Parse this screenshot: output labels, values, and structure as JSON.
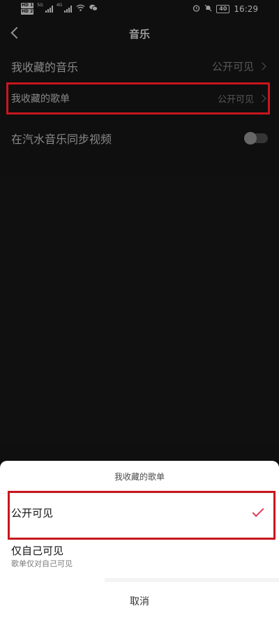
{
  "status_bar": {
    "hd1": "HD 1",
    "hd2": "HD 2",
    "network1": "5G",
    "network2": "4G",
    "battery": "40",
    "time": "16:29",
    "icons": [
      "signal-icon",
      "wifi-icon",
      "wechat-icon",
      "alarm-icon",
      "mute-icon",
      "battery-icon"
    ]
  },
  "nav": {
    "title": "音乐",
    "back_icon": "back-chevron-icon"
  },
  "settings": {
    "items": [
      {
        "label": "我收藏的音乐",
        "value": "公开可见"
      },
      {
        "label": "我收藏的歌单",
        "value": "公开可见"
      },
      {
        "label": "在汽水音乐同步视频",
        "toggle": false
      }
    ]
  },
  "sheet": {
    "title": "我收藏的歌单",
    "options": [
      {
        "label": "公开可见",
        "selected": true
      },
      {
        "label": "仅自己可见",
        "sub": "歌单仅对自己可见",
        "selected": false
      }
    ],
    "cancel": "取消"
  },
  "colors": {
    "background": "#161616",
    "highlight": "#c8161e",
    "check": "#e03a5a",
    "sheet": "#ffffff"
  }
}
